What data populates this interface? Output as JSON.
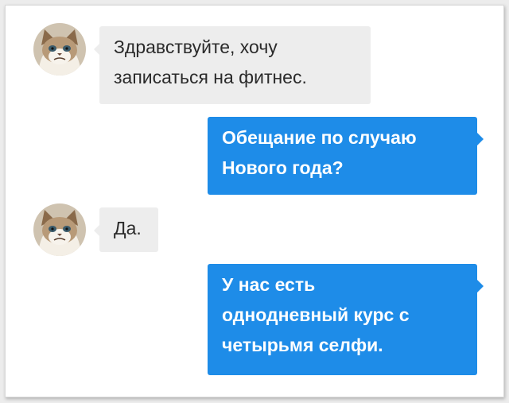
{
  "conversation": {
    "messages": [
      {
        "sender": "them",
        "lines": [
          "Здравствуйте, хочу",
          "записаться на фитнес."
        ]
      },
      {
        "sender": "me",
        "lines": [
          "Обещание по случаю",
          "Нового года?"
        ]
      },
      {
        "sender": "them",
        "lines": [
          "Да."
        ]
      },
      {
        "sender": "me",
        "lines": [
          "У нас есть",
          "однодневный курс с",
          "четырьмя селфи."
        ]
      }
    ]
  },
  "colors": {
    "incoming_bubble": "#ededed",
    "outgoing_bubble": "#1e8ce8",
    "background": "#ffffff"
  },
  "icons": {
    "avatar": "grumpy-cat-avatar-icon"
  }
}
